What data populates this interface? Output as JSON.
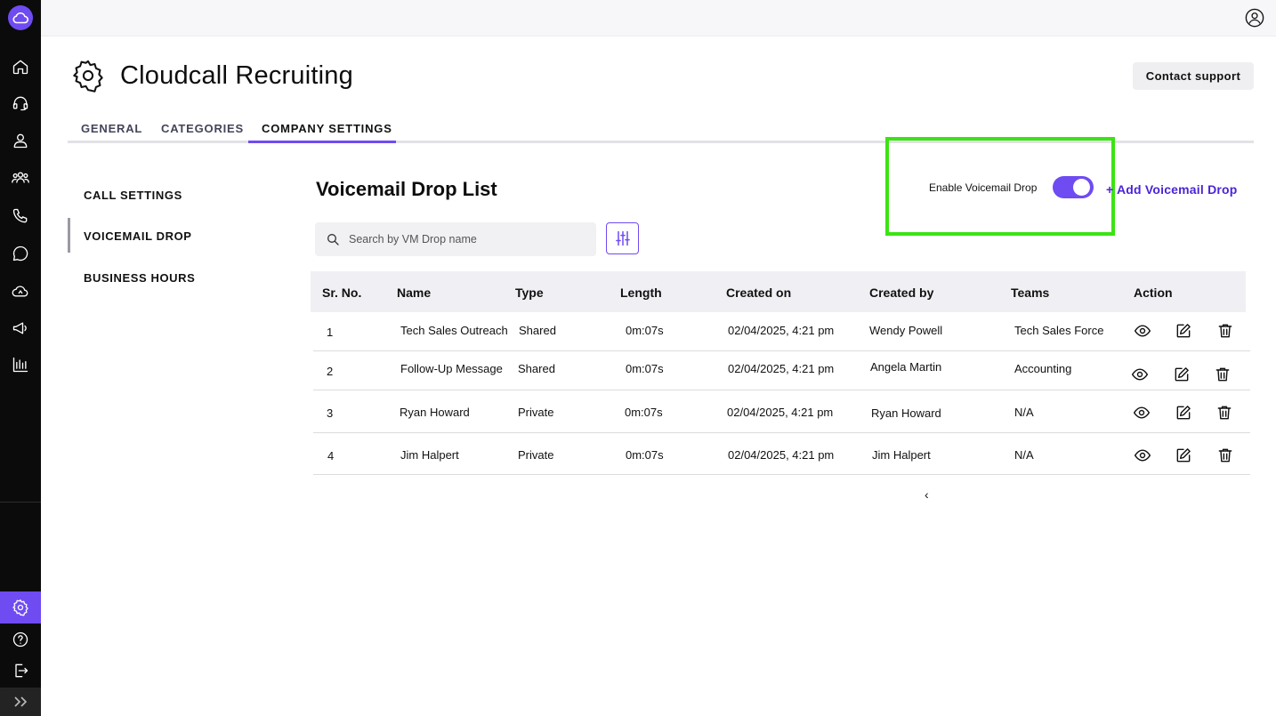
{
  "sidebar": {
    "logo": "cloud-logo-icon",
    "items": [
      {
        "icon": "home-icon"
      },
      {
        "icon": "headset-icon"
      },
      {
        "icon": "user-icon"
      },
      {
        "icon": "users-group-icon"
      },
      {
        "icon": "phone-icon"
      },
      {
        "icon": "chat-icon"
      },
      {
        "icon": "cloud-sync-icon"
      },
      {
        "icon": "megaphone-icon"
      },
      {
        "icon": "bar-chart-icon"
      }
    ],
    "bottom_items": [
      {
        "icon": "gear-icon",
        "active": true
      },
      {
        "icon": "help-icon"
      },
      {
        "icon": "logout-icon"
      }
    ],
    "expand_icon": "double-chevron-right-icon",
    "accent": "#6f4bf2"
  },
  "header": {
    "title": "Cloudcall Recruiting",
    "contact_support": "Contact support"
  },
  "tabs": [
    {
      "label": "GENERAL"
    },
    {
      "label": "CATEGORIES"
    },
    {
      "label": "COMPANY SETTINGS",
      "active": true
    }
  ],
  "side_menu": [
    {
      "label": "CALL SETTINGS"
    },
    {
      "label": "VOICEMAIL DROP",
      "active": true
    },
    {
      "label": "BUSINESS HOURS"
    }
  ],
  "main": {
    "title": "Voicemail Drop List",
    "enable_label": "Enable Voicemail  Drop",
    "enable_on": true,
    "add_label": "+ Add Voicemail Drop",
    "search_placeholder": "Search by VM Drop name",
    "highlight_color": "#3ce313"
  },
  "table": {
    "columns": [
      "Sr. No.",
      "Name",
      "Type",
      "Length",
      "Created on",
      "Created by",
      "Teams",
      "Action"
    ],
    "rows": [
      {
        "sr": "1",
        "name": "Tech Sales Outreach",
        "type": "Shared",
        "length": "0m:07s",
        "created_on": "02/04/2025, 4:21 pm",
        "created_by": "Wendy Powell",
        "teams": "Tech Sales Force"
      },
      {
        "sr": "2",
        "name": "Follow-Up Message",
        "type": "Shared",
        "length": "0m:07s",
        "created_on": "02/04/2025, 4:21 pm",
        "created_by": "Angela Martin",
        "teams": "Accounting"
      },
      {
        "sr": "3",
        "name": "Ryan Howard",
        "type": "Private",
        "length": "0m:07s",
        "created_on": "02/04/2025, 4:21 pm",
        "created_by": "Ryan Howard",
        "teams": "N/A"
      },
      {
        "sr": "4",
        "name": "Jim Halpert",
        "type": "Private",
        "length": "0m:07s",
        "created_on": "02/04/2025, 4:21 pm",
        "created_by": "Jim Halpert",
        "teams": "N/A"
      }
    ]
  },
  "pagination": {
    "prev": "‹"
  }
}
